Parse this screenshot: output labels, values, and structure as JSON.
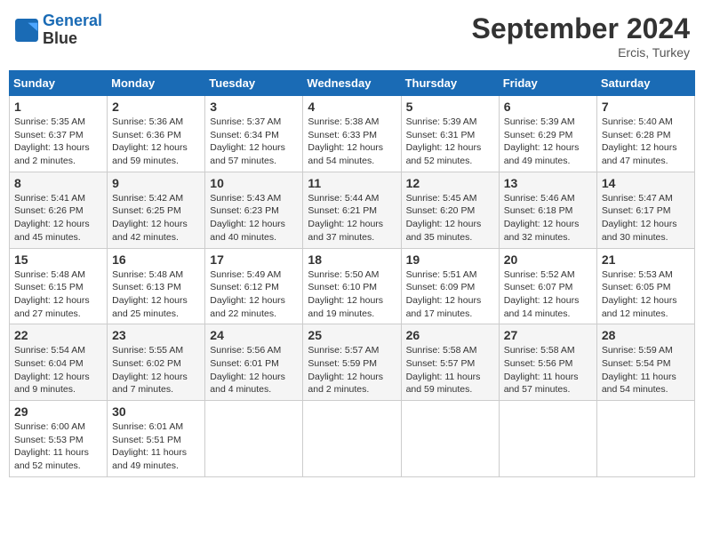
{
  "header": {
    "logo_line1": "General",
    "logo_line2": "Blue",
    "month_title": "September 2024",
    "location": "Ercis, Turkey"
  },
  "weekdays": [
    "Sunday",
    "Monday",
    "Tuesday",
    "Wednesday",
    "Thursday",
    "Friday",
    "Saturday"
  ],
  "weeks": [
    [
      {
        "day": "1",
        "sunrise": "Sunrise: 5:35 AM",
        "sunset": "Sunset: 6:37 PM",
        "daylight": "Daylight: 13 hours and 2 minutes."
      },
      {
        "day": "2",
        "sunrise": "Sunrise: 5:36 AM",
        "sunset": "Sunset: 6:36 PM",
        "daylight": "Daylight: 12 hours and 59 minutes."
      },
      {
        "day": "3",
        "sunrise": "Sunrise: 5:37 AM",
        "sunset": "Sunset: 6:34 PM",
        "daylight": "Daylight: 12 hours and 57 minutes."
      },
      {
        "day": "4",
        "sunrise": "Sunrise: 5:38 AM",
        "sunset": "Sunset: 6:33 PM",
        "daylight": "Daylight: 12 hours and 54 minutes."
      },
      {
        "day": "5",
        "sunrise": "Sunrise: 5:39 AM",
        "sunset": "Sunset: 6:31 PM",
        "daylight": "Daylight: 12 hours and 52 minutes."
      },
      {
        "day": "6",
        "sunrise": "Sunrise: 5:39 AM",
        "sunset": "Sunset: 6:29 PM",
        "daylight": "Daylight: 12 hours and 49 minutes."
      },
      {
        "day": "7",
        "sunrise": "Sunrise: 5:40 AM",
        "sunset": "Sunset: 6:28 PM",
        "daylight": "Daylight: 12 hours and 47 minutes."
      }
    ],
    [
      {
        "day": "8",
        "sunrise": "Sunrise: 5:41 AM",
        "sunset": "Sunset: 6:26 PM",
        "daylight": "Daylight: 12 hours and 45 minutes."
      },
      {
        "day": "9",
        "sunrise": "Sunrise: 5:42 AM",
        "sunset": "Sunset: 6:25 PM",
        "daylight": "Daylight: 12 hours and 42 minutes."
      },
      {
        "day": "10",
        "sunrise": "Sunrise: 5:43 AM",
        "sunset": "Sunset: 6:23 PM",
        "daylight": "Daylight: 12 hours and 40 minutes."
      },
      {
        "day": "11",
        "sunrise": "Sunrise: 5:44 AM",
        "sunset": "Sunset: 6:21 PM",
        "daylight": "Daylight: 12 hours and 37 minutes."
      },
      {
        "day": "12",
        "sunrise": "Sunrise: 5:45 AM",
        "sunset": "Sunset: 6:20 PM",
        "daylight": "Daylight: 12 hours and 35 minutes."
      },
      {
        "day": "13",
        "sunrise": "Sunrise: 5:46 AM",
        "sunset": "Sunset: 6:18 PM",
        "daylight": "Daylight: 12 hours and 32 minutes."
      },
      {
        "day": "14",
        "sunrise": "Sunrise: 5:47 AM",
        "sunset": "Sunset: 6:17 PM",
        "daylight": "Daylight: 12 hours and 30 minutes."
      }
    ],
    [
      {
        "day": "15",
        "sunrise": "Sunrise: 5:48 AM",
        "sunset": "Sunset: 6:15 PM",
        "daylight": "Daylight: 12 hours and 27 minutes."
      },
      {
        "day": "16",
        "sunrise": "Sunrise: 5:48 AM",
        "sunset": "Sunset: 6:13 PM",
        "daylight": "Daylight: 12 hours and 25 minutes."
      },
      {
        "day": "17",
        "sunrise": "Sunrise: 5:49 AM",
        "sunset": "Sunset: 6:12 PM",
        "daylight": "Daylight: 12 hours and 22 minutes."
      },
      {
        "day": "18",
        "sunrise": "Sunrise: 5:50 AM",
        "sunset": "Sunset: 6:10 PM",
        "daylight": "Daylight: 12 hours and 19 minutes."
      },
      {
        "day": "19",
        "sunrise": "Sunrise: 5:51 AM",
        "sunset": "Sunset: 6:09 PM",
        "daylight": "Daylight: 12 hours and 17 minutes."
      },
      {
        "day": "20",
        "sunrise": "Sunrise: 5:52 AM",
        "sunset": "Sunset: 6:07 PM",
        "daylight": "Daylight: 12 hours and 14 minutes."
      },
      {
        "day": "21",
        "sunrise": "Sunrise: 5:53 AM",
        "sunset": "Sunset: 6:05 PM",
        "daylight": "Daylight: 12 hours and 12 minutes."
      }
    ],
    [
      {
        "day": "22",
        "sunrise": "Sunrise: 5:54 AM",
        "sunset": "Sunset: 6:04 PM",
        "daylight": "Daylight: 12 hours and 9 minutes."
      },
      {
        "day": "23",
        "sunrise": "Sunrise: 5:55 AM",
        "sunset": "Sunset: 6:02 PM",
        "daylight": "Daylight: 12 hours and 7 minutes."
      },
      {
        "day": "24",
        "sunrise": "Sunrise: 5:56 AM",
        "sunset": "Sunset: 6:01 PM",
        "daylight": "Daylight: 12 hours and 4 minutes."
      },
      {
        "day": "25",
        "sunrise": "Sunrise: 5:57 AM",
        "sunset": "Sunset: 5:59 PM",
        "daylight": "Daylight: 12 hours and 2 minutes."
      },
      {
        "day": "26",
        "sunrise": "Sunrise: 5:58 AM",
        "sunset": "Sunset: 5:57 PM",
        "daylight": "Daylight: 11 hours and 59 minutes."
      },
      {
        "day": "27",
        "sunrise": "Sunrise: 5:58 AM",
        "sunset": "Sunset: 5:56 PM",
        "daylight": "Daylight: 11 hours and 57 minutes."
      },
      {
        "day": "28",
        "sunrise": "Sunrise: 5:59 AM",
        "sunset": "Sunset: 5:54 PM",
        "daylight": "Daylight: 11 hours and 54 minutes."
      }
    ],
    [
      {
        "day": "29",
        "sunrise": "Sunrise: 6:00 AM",
        "sunset": "Sunset: 5:53 PM",
        "daylight": "Daylight: 11 hours and 52 minutes."
      },
      {
        "day": "30",
        "sunrise": "Sunrise: 6:01 AM",
        "sunset": "Sunset: 5:51 PM",
        "daylight": "Daylight: 11 hours and 49 minutes."
      },
      null,
      null,
      null,
      null,
      null
    ]
  ]
}
